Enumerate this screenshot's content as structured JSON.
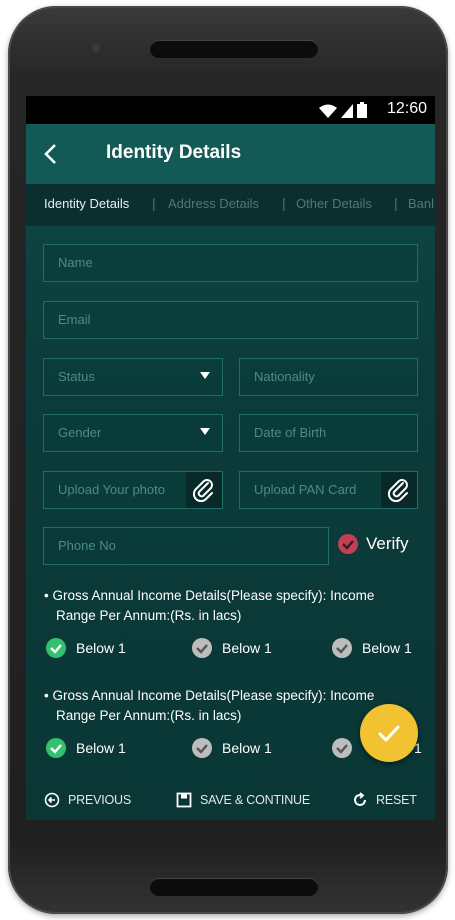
{
  "status_bar": {
    "time": "12:60",
    "icons": [
      "wifi-icon",
      "signal-icon",
      "battery-icon"
    ]
  },
  "app_bar": {
    "title": "Identity Details",
    "back_icon": "chevron-left-icon"
  },
  "tabs": [
    {
      "label": "Identity Details",
      "active": true
    },
    {
      "label": "Address Details",
      "active": false
    },
    {
      "label": "Other Details",
      "active": false
    },
    {
      "label": "Banl",
      "active": false
    }
  ],
  "form": {
    "name": {
      "placeholder": "Name"
    },
    "email": {
      "placeholder": "Email"
    },
    "status": {
      "placeholder": "Status"
    },
    "nationality": {
      "placeholder": "Nationality"
    },
    "gender": {
      "placeholder": "Gender"
    },
    "dob": {
      "placeholder": "Date of Birth"
    },
    "photo": {
      "placeholder": "Upload Your photo"
    },
    "pan": {
      "placeholder": "Upload PAN Card"
    },
    "phone": {
      "placeholder": "Phone No"
    },
    "verify_label": "Verify"
  },
  "income_questions": [
    {
      "line1": "• Gross Annual Income Details(Please specify): Income",
      "line2": "Range Per Annum:(Rs. in lacs)",
      "options": [
        {
          "label": "Below 1",
          "selected": true
        },
        {
          "label": "Below 1",
          "selected": false
        },
        {
          "label": "Below 1",
          "selected": false
        }
      ]
    },
    {
      "line1": "• Gross Annual Income Details(Please specify): Income",
      "line2": "Range Per Annum:(Rs. in lacs)",
      "options": [
        {
          "label": "Below 1",
          "selected": true
        },
        {
          "label": "Below 1",
          "selected": false
        },
        {
          "label": "1",
          "selected": false
        }
      ]
    }
  ],
  "bottom_bar": {
    "previous": "PREVIOUS",
    "save": "SAVE & CONTINUE",
    "reset": "RESET"
  },
  "colors": {
    "accent": "#f1c232",
    "selected": "#34c16e",
    "verify": "#c53f54",
    "background": "#0b3b3a"
  }
}
